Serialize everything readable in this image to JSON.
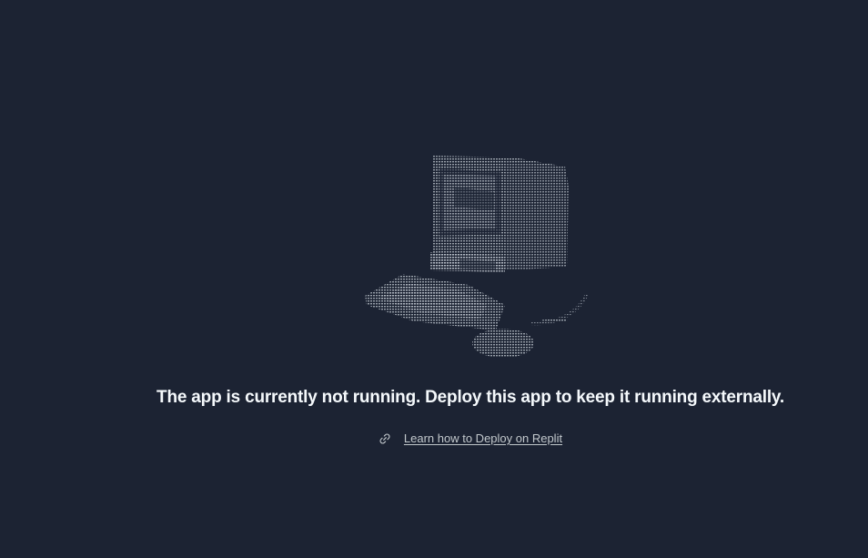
{
  "message": {
    "text": "The app is currently not running. Deploy this app to keep it running externally."
  },
  "learn": {
    "icon": "link-icon",
    "label": "Learn how to Deploy on Replit"
  },
  "illustration": {
    "name": "ascii-computer-illustration",
    "color": "#9aa1ab"
  },
  "colors": {
    "background": "#1c2333",
    "heading": "#f5f9fc",
    "link": "#c2c8cc"
  }
}
